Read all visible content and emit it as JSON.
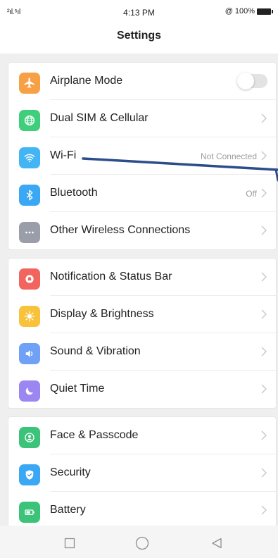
{
  "status_bar": {
    "signal": "²ıl.⁵ıl",
    "time": "4:13 PM",
    "battery_text": "100%",
    "lock_glyph": "@"
  },
  "header": {
    "title": "Settings"
  },
  "groups": [
    {
      "items": [
        {
          "label": "Airplane Mode",
          "icon": "airplane-icon",
          "color": "#f7a046",
          "control": "toggle",
          "toggle_on": false
        },
        {
          "label": "Dual SIM & Cellular",
          "icon": "globe-icon",
          "color": "#3fcf7c",
          "control": "chevron"
        },
        {
          "label": "Wi-Fi",
          "icon": "wifi-icon",
          "color": "#43b5f4",
          "control": "chevron",
          "value": "Not Connected"
        },
        {
          "label": "Bluetooth",
          "icon": "bluetooth-icon",
          "color": "#3aa8f5",
          "control": "chevron",
          "value": "Off"
        },
        {
          "label": "Other Wireless Connections",
          "icon": "more-icon",
          "color": "#9a9ea8",
          "control": "chevron"
        }
      ]
    },
    {
      "items": [
        {
          "label": "Notification & Status Bar",
          "icon": "notification-icon",
          "color": "#f2655f",
          "control": "chevron"
        },
        {
          "label": "Display & Brightness",
          "icon": "brightness-icon",
          "color": "#f8c33b",
          "control": "chevron"
        },
        {
          "label": "Sound & Vibration",
          "icon": "speaker-icon",
          "color": "#6fa2f7",
          "control": "chevron"
        },
        {
          "label": "Quiet Time",
          "icon": "moon-icon",
          "color": "#9c86f2",
          "control": "chevron"
        }
      ]
    },
    {
      "items": [
        {
          "label": "Face & Passcode",
          "icon": "face-icon",
          "color": "#3cc37a",
          "control": "chevron"
        },
        {
          "label": "Security",
          "icon": "shield-icon",
          "color": "#3aa8f5",
          "control": "chevron"
        },
        {
          "label": "Battery",
          "icon": "battery-icon",
          "color": "#3cc37a",
          "control": "chevron"
        }
      ]
    }
  ],
  "annotation": {
    "color": "#2c4c8c"
  }
}
